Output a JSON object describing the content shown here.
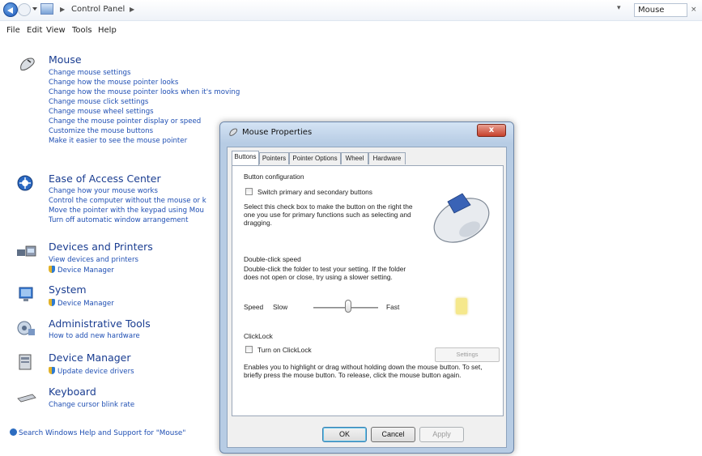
{
  "window": {
    "breadcrumb": "Control Panel",
    "search_value": "Mouse"
  },
  "menu": [
    "File",
    "Edit",
    "View",
    "Tools",
    "Help"
  ],
  "results": [
    {
      "title": "Mouse",
      "icon": "mouse-icon",
      "links": [
        "Change mouse settings",
        "Change how the mouse pointer looks",
        "Change how the mouse pointer looks when it's moving",
        "Change mouse click settings",
        "Change mouse wheel settings",
        "Change the mouse pointer display or speed",
        "Customize the mouse buttons",
        "Make it easier to see the mouse pointer"
      ]
    },
    {
      "title": "Ease of Access Center",
      "icon": "ease-of-access-icon",
      "links": [
        "Change how your mouse works",
        "Control the computer without the mouse or k",
        "Move the pointer with the keypad using Mou",
        "Turn off automatic window arrangement"
      ]
    },
    {
      "title": "Devices and Printers",
      "icon": "devices-printers-icon",
      "links": [
        "View devices and printers",
        "Device Manager"
      ]
    },
    {
      "title": "System",
      "icon": "system-icon",
      "links": [
        "Device Manager"
      ]
    },
    {
      "title": "Administrative Tools",
      "icon": "admin-tools-icon",
      "links": [
        "How to add new hardware"
      ]
    },
    {
      "title": "Device Manager",
      "icon": "device-manager-icon",
      "links": [
        "Update device drivers"
      ]
    },
    {
      "title": "Keyboard",
      "icon": "keyboard-icon",
      "links": [
        "Change cursor blink rate"
      ]
    }
  ],
  "help_link": "Search Windows Help and Support for \"Mouse\"",
  "dialog": {
    "title": "Mouse Properties",
    "close": "x",
    "tabs": [
      "Buttons",
      "Pointers",
      "Pointer Options",
      "Wheel",
      "Hardware"
    ],
    "active_tab": "Buttons",
    "button_config": {
      "heading": "Button configuration",
      "checkbox_label": "Switch primary and secondary buttons",
      "checked": false,
      "description": "Select this check box to make the button on the right the one you use for primary functions such as selecting and dragging."
    },
    "double_click": {
      "heading": "Double-click speed",
      "description": "Double-click the folder to test your setting. If the folder does not open or close, try using a slower setting.",
      "speed_label": "Speed",
      "slow_label": "Slow",
      "fast_label": "Fast",
      "speed_value": 0.5
    },
    "clicklock": {
      "heading": "ClickLock",
      "checkbox_label": "Turn on ClickLock",
      "checked": false,
      "settings_button": "Settings",
      "description": "Enables you to highlight or drag without holding down the mouse button. To set, briefly press the mouse button. To release, click the mouse button again."
    },
    "buttons": {
      "ok": "OK",
      "cancel": "Cancel",
      "apply": "Apply"
    }
  }
}
